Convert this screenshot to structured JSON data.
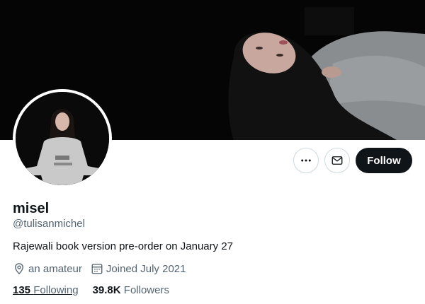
{
  "profile": {
    "display_name": "misel",
    "handle": "@tulisanmichel",
    "bio": "Rajewali book version pre-order on January 27",
    "location": "an amateur",
    "joined": "Joined July 2021"
  },
  "stats": {
    "following_count": "135",
    "following_label": "Following",
    "followers_count": "39.8K",
    "followers_label": "Followers"
  },
  "actions": {
    "follow_label": "Follow",
    "more_icon": "more-horizontal-icon",
    "message_icon": "envelope-icon"
  },
  "icons": {
    "location": "location-pin-icon",
    "calendar": "calendar-icon"
  },
  "colors": {
    "primary_text": "#0f1419",
    "secondary_text": "#536471",
    "follow_button": "#0f1419",
    "border": "#cfd9de"
  }
}
